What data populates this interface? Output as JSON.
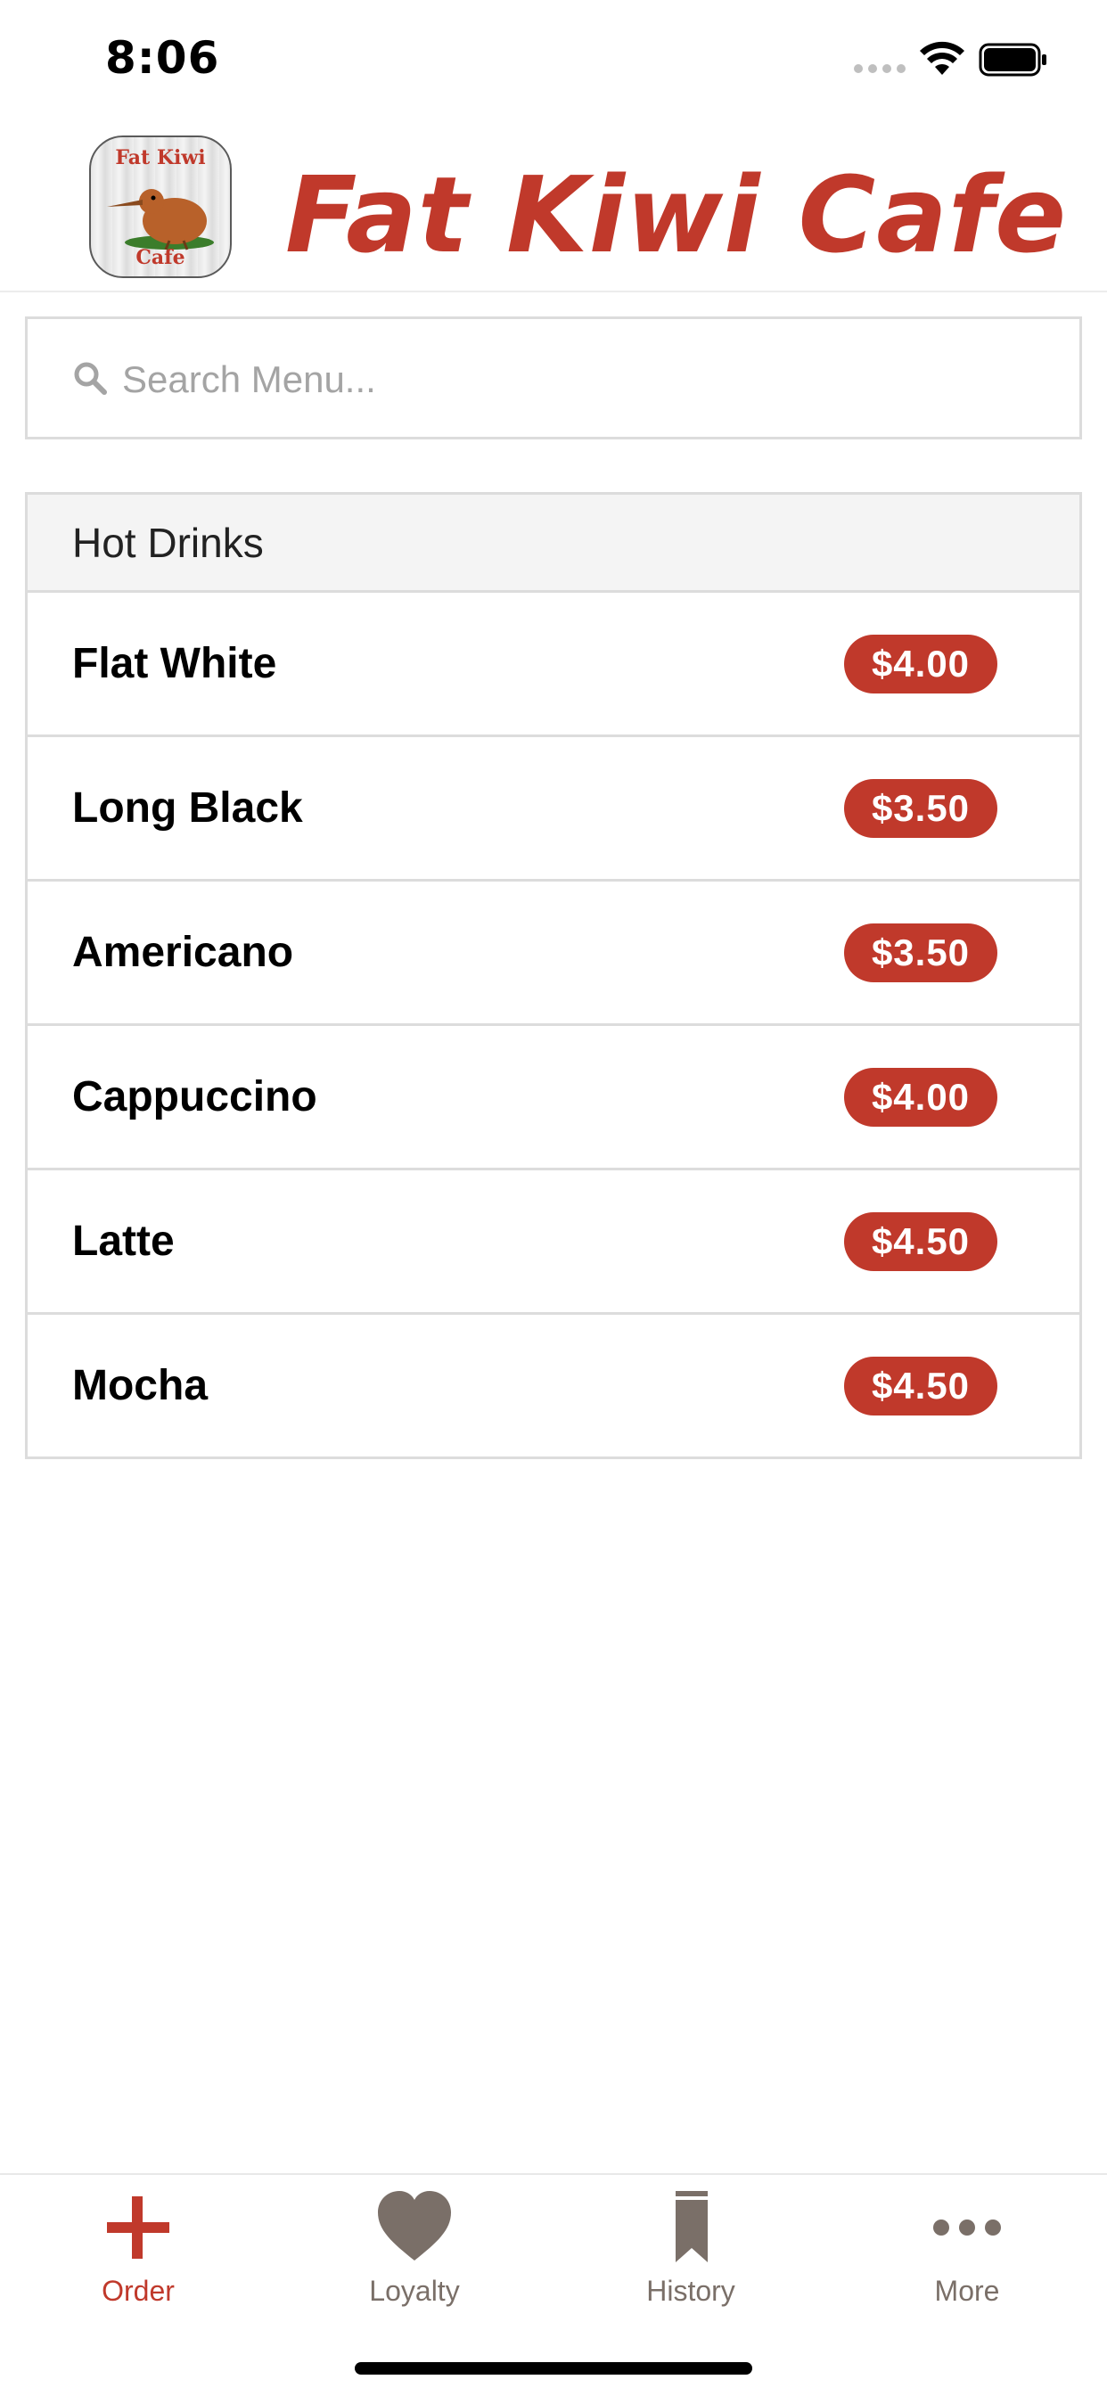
{
  "status_bar": {
    "time": "8:06"
  },
  "header": {
    "title": "Fat Kiwi Cafe",
    "logo_text_top": "Fat Kiwi",
    "logo_text_bottom": "Cafe"
  },
  "search": {
    "placeholder": "Search Menu...",
    "value": ""
  },
  "menu": {
    "section_title": "Hot Drinks",
    "items": [
      {
        "name": "Flat White",
        "price": "$4.00"
      },
      {
        "name": "Long Black",
        "price": "$3.50"
      },
      {
        "name": "Americano",
        "price": "$3.50"
      },
      {
        "name": "Cappuccino",
        "price": "$4.00"
      },
      {
        "name": "Latte",
        "price": "$4.50"
      },
      {
        "name": "Mocha",
        "price": "$4.50"
      }
    ]
  },
  "tabs": [
    {
      "label": "Order",
      "icon": "plus-icon",
      "active": true
    },
    {
      "label": "Loyalty",
      "icon": "heart-icon",
      "active": false
    },
    {
      "label": "History",
      "icon": "bookmark-icon",
      "active": false
    },
    {
      "label": "More",
      "icon": "more-dots-icon",
      "active": false
    }
  ],
  "colors": {
    "accent": "#c0392b",
    "tab_inactive": "#7a6f68",
    "border": "#dcdcdc",
    "section_bg": "#f4f4f4"
  }
}
